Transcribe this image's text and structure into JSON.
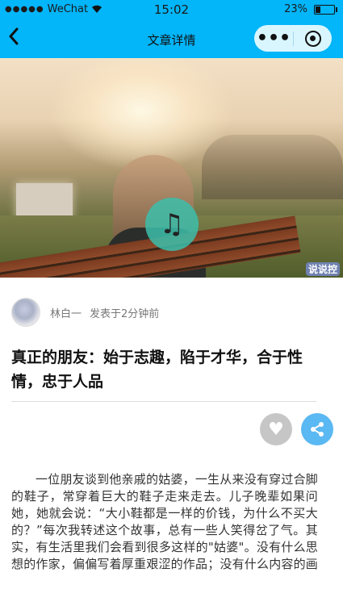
{
  "status_bar": {
    "signal": "●●●●●",
    "carrier": "WeChat",
    "time": "15:02",
    "battery": "23%"
  },
  "nav": {
    "back_glyph": "‹",
    "title": "文章详情",
    "more_glyph": "•••"
  },
  "hero": {
    "watermark": "说说控",
    "music_glyph": "♫"
  },
  "author": {
    "name": "林白一",
    "posted": "发表于2分钟前"
  },
  "article": {
    "title": "真正的朋友：始于志趣，陷于才华，合于性情，忠于人品",
    "body": "一位朋友谈到他亲戚的姑婆，一生从来没有穿过合脚的鞋子，常穿着巨大的鞋子走来走去。儿子晚辈如果问她，她就会说：“大小鞋都是一样的价钱，为什么不买大的？”每次我转述这个故事，总有一些人笑得岔了气。其实，有生活里我们会看到很多这样的\"姑婆\"。没有什么思想的作家，偏偏写着厚重艰涩的作品；没有什么内容的画"
  },
  "actions": {
    "like_glyph": "♥"
  }
}
